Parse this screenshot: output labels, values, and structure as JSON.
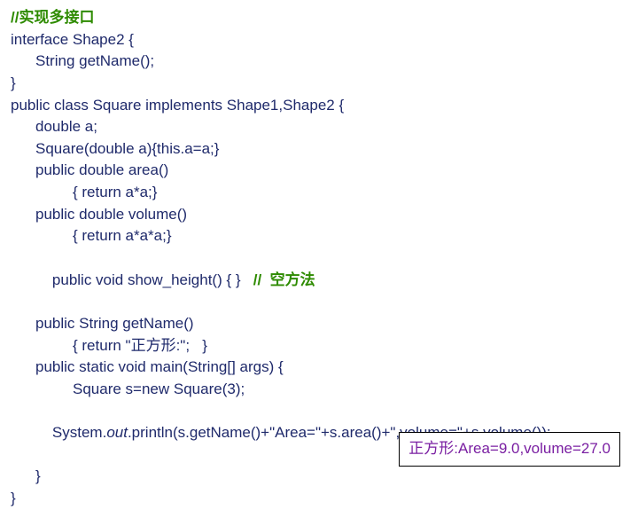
{
  "code": {
    "c1": "//实现多接口",
    "l1": "interface Shape2 {",
    "l2": "String getName();",
    "l3": "}",
    "l4": "public class Square implements Shape1,Shape2 {",
    "l5": "double a;",
    "l6": "Square(double a){this.a=a;}",
    "l7": "public double area()",
    "l8": "{ return a*a;}",
    "l9": "public double volume()",
    "l10": "{ return a*a*a;}",
    "l11a": "public void show_height() { }   ",
    "c2": "//  空方法",
    "l12": "public String getName()",
    "l13": "{ return \"正方形:\";   }",
    "l14": "public static void main(String[] args) {",
    "l15": "Square s=new Square(3);",
    "l16prefix": "System.",
    "l16out": "out",
    "l16suffix": ".println(s.getName()+\"Area=\"+s.area()+\",volume=\"+s.volume());",
    "l17": "}",
    "l18": "}"
  },
  "output": "正方形:Area=9.0,volume=27.0"
}
